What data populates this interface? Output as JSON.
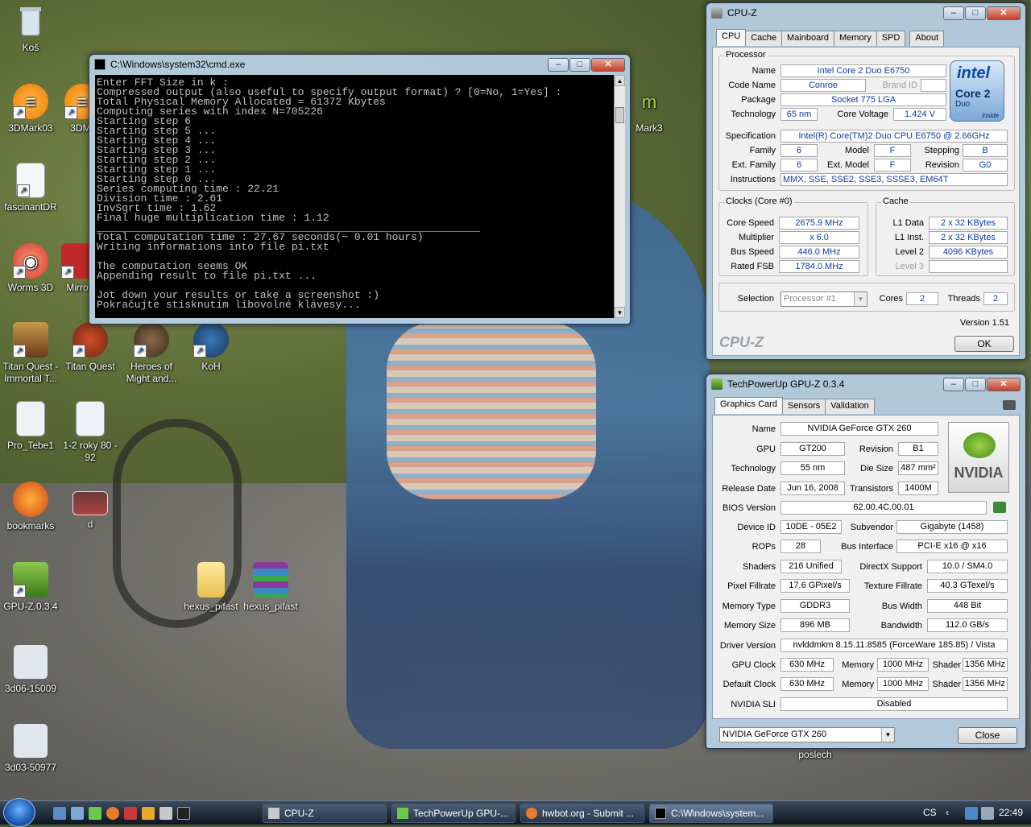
{
  "desktop": {
    "icons": [
      {
        "label": "Koš",
        "icon": "recycle-bin-icon"
      },
      {
        "label": "3DMark03",
        "icon": "3dmark-icon"
      },
      {
        "label": "3DM",
        "icon": "3dmark-icon"
      },
      {
        "label": "Mark3",
        "icon": "app-icon"
      },
      {
        "label": "fascinantDR",
        "icon": "document-icon"
      },
      {
        "label": "Worms 3D",
        "icon": "worms-icon"
      },
      {
        "label": "Mirro",
        "icon": "app-icon"
      },
      {
        "label": "Titan Quest - Immortal T...",
        "icon": "titan-quest-icon"
      },
      {
        "label": "Titan Quest",
        "icon": "titan-quest-icon"
      },
      {
        "label": "Heroes of Might and...",
        "icon": "heroes-icon"
      },
      {
        "label": "KoH",
        "icon": "koh-icon"
      },
      {
        "label": "Pro_Tebe1",
        "icon": "document-icon"
      },
      {
        "label": "1-2 roky 80 - 92",
        "icon": "document-icon"
      },
      {
        "label": "bookmarks",
        "icon": "firefox-icon"
      },
      {
        "label": "d",
        "icon": "image-icon"
      },
      {
        "label": "GPU-Z.0.3.4",
        "icon": "gpuz-icon"
      },
      {
        "label": "hexus_pifast",
        "icon": "folder-icon"
      },
      {
        "label": "hexus_pifast",
        "icon": "winrar-icon"
      },
      {
        "label": "3d06-15009",
        "icon": "image-icon"
      },
      {
        "label": "3d03-50977",
        "icon": "image-icon"
      },
      {
        "label": "poslech",
        "icon": "app-icon"
      }
    ]
  },
  "cmd": {
    "title": "C:\\Windows\\system32\\cmd.exe",
    "lines": [
      "Enter FFT Size in k :",
      "Compressed output (also useful to specify output format) ? [0=No, 1=Yes] :",
      "Total Physical Memory Allocated = 61372 Kbytes",
      "Computing series with index N=705226",
      "Starting step 6",
      "Starting step 5 ...",
      "Starting step 4 ...",
      "Starting step 3 ...",
      "Starting step 2 ...",
      "Starting step 1 ...",
      "Starting step 0 ...",
      "Series computing time : 22.21",
      "Division time : 2.61",
      "InvSqrt time : 1.62",
      "Final huge multiplication time : 1.12",
      "_____________________________________________________________",
      "Total computation time : 27.67 seconds(~ 0.01 hours)",
      "Writing informations into file pi.txt",
      "",
      "The computation seems OK",
      "Appending result to file pi.txt ...",
      "",
      "Jot down your results or take a screenshot :)",
      "Pokračujte stisknutím libovolné klávesy..."
    ]
  },
  "cpuz": {
    "title": "CPU-Z",
    "tabs": [
      "CPU",
      "Cache",
      "Mainboard",
      "Memory",
      "SPD",
      "About"
    ],
    "processor_label": "Processor",
    "name_l": "Name",
    "name": "Intel Core 2 Duo E6750",
    "codename_l": "Code Name",
    "codename": "Conroe",
    "brandid_l": "Brand ID",
    "package_l": "Package",
    "package": "Socket 775 LGA",
    "technology_l": "Technology",
    "technology": "65 nm",
    "corevoltage_l": "Core Voltage",
    "corevoltage": "1.424 V",
    "spec_l": "Specification",
    "spec": "Intel(R) Core(TM)2 Duo CPU     E6750  @ 2.66GHz",
    "family_l": "Family",
    "family": "6",
    "model_l": "Model",
    "model": "F",
    "stepping_l": "Stepping",
    "stepping": "B",
    "extfamily_l": "Ext. Family",
    "extfamily": "6",
    "extmodel_l": "Ext. Model",
    "extmodel": "F",
    "revision_l": "Revision",
    "revision": "G0",
    "instructions_l": "Instructions",
    "instructions": "MMX, SSE, SSE2, SSE3, SSSE3, EM64T",
    "clocks_label": "Clocks (Core #0)",
    "corespeed_l": "Core Speed",
    "corespeed": "2675.9 MHz",
    "multiplier_l": "Multiplier",
    "multiplier": "x 6.0",
    "busspeed_l": "Bus Speed",
    "busspeed": "446.0 MHz",
    "ratedfsb_l": "Rated FSB",
    "ratedfsb": "1784.0 MHz",
    "cache_label": "Cache",
    "l1data_l": "L1 Data",
    "l1data": "2 x 32 KBytes",
    "l1inst_l": "L1 Inst.",
    "l1inst": "2 x 32 KBytes",
    "level2_l": "Level 2",
    "level2": "4096 KBytes",
    "level3_l": "Level 3",
    "selection_l": "Selection",
    "selection": "Processor #1",
    "cores_l": "Cores",
    "cores": "2",
    "threads_l": "Threads",
    "threads": "2",
    "version": "Version 1.51",
    "brand": "CPU-Z",
    "ok": "OK",
    "logo": {
      "intel": "intel",
      "core": "Core 2",
      "duo": "Duo",
      "inside": "inside"
    }
  },
  "gpuz": {
    "title": "TechPowerUp GPU-Z 0.3.4",
    "tabs": [
      "Graphics Card",
      "Sensors",
      "Validation"
    ],
    "name_l": "Name",
    "name": "NVIDIA GeForce GTX 260",
    "gpu_l": "GPU",
    "gpu": "GT200",
    "revision_l": "Revision",
    "revision": "B1",
    "technology_l": "Technology",
    "technology": "55 nm",
    "diesize_l": "Die Size",
    "diesize": "487 mm²",
    "releasedate_l": "Release Date",
    "releasedate": "Jun 16, 2008",
    "transistors_l": "Transistors",
    "transistors": "1400M",
    "bios_l": "BIOS Version",
    "bios": "62.00.4C.00.01",
    "deviceid_l": "Device ID",
    "deviceid": "10DE - 05E2",
    "subvendor_l": "Subvendor",
    "subvendor": "Gigabyte (1458)",
    "rops_l": "ROPs",
    "rops": "28",
    "businterface_l": "Bus Interface",
    "businterface": "PCI-E x16 @ x16",
    "shaders_l": "Shaders",
    "shaders": "216 Unified",
    "directx_l": "DirectX Support",
    "directx": "10.0 / SM4.0",
    "pixelfill_l": "Pixel Fillrate",
    "pixelfill": "17.6 GPixel/s",
    "texturefill_l": "Texture Fillrate",
    "texturefill": "40.3 GTexel/s",
    "memtype_l": "Memory Type",
    "memtype": "GDDR3",
    "buswidth_l": "Bus Width",
    "buswidth": "448 Bit",
    "memsize_l": "Memory Size",
    "memsize": "896 MB",
    "bandwidth_l": "Bandwidth",
    "bandwidth": "112.0 GB/s",
    "driver_l": "Driver Version",
    "driver": "nvlddmkm 8.15.11.8585 (ForceWare 185.85) / Vista",
    "gpuclock_l": "GPU Clock",
    "gpuclock": "630 MHz",
    "memory_l": "Memory",
    "memclock": "1000 MHz",
    "shader_l": "Shader",
    "shaderclock": "1356 MHz",
    "defclock_l": "Default Clock",
    "defclock": "630 MHz",
    "defmem": "1000 MHz",
    "defshader": "1356 MHz",
    "sli_l": "NVIDIA SLI",
    "sli": "Disabled",
    "selected_card": "NVIDIA GeForce GTX 260",
    "close": "Close",
    "logo": "NVIDIA"
  },
  "taskbar": {
    "items": [
      {
        "label": "CPU-Z"
      },
      {
        "label": "TechPowerUp GPU-..."
      },
      {
        "label": "hwbot.org - Submit ..."
      },
      {
        "label": "C:\\Windows\\system..."
      }
    ],
    "language": "CS",
    "clock": "22:49"
  }
}
